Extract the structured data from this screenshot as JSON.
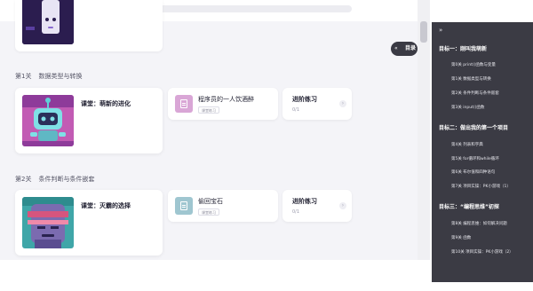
{
  "sections": [
    {
      "title_prefix": "第1关",
      "title_text": "数据类型与转换",
      "course": {
        "title": "课堂：萌新的进化"
      },
      "item": {
        "title": "程序员的一人饮酒醉",
        "tag": "课堂练习"
      },
      "practice": {
        "title": "进阶练习",
        "progress": "0/1"
      }
    },
    {
      "title_prefix": "第2关",
      "title_text": "条件判断与条件嵌套",
      "course": {
        "title": "课堂：灭霸的选择"
      },
      "item": {
        "title": "偷回宝石",
        "tag": "课堂练习"
      },
      "practice": {
        "title": "进阶练习",
        "progress": "0/1"
      }
    }
  ],
  "toggle": {
    "label": "目录",
    "icon": "chevron-double-left-icon"
  },
  "sidebar": {
    "collapse_icon": "chevron-double-right-icon",
    "goals": [
      {
        "title": "目标一：刚叫我萌新",
        "lessons": [
          "第0关 print()函数与变量",
          "第1关 数据类型与转换",
          "第2关 条件判断与条件嵌套",
          "第3关 input()函数"
        ]
      },
      {
        "title": "目标二：做出我的第一个项目",
        "lessons": [
          "第4关 列表和字典",
          "第5关 for循环和while循环",
          "第6关 布尔值和四种语句",
          "第7关 项目实操：PK小游戏（1）"
        ]
      },
      {
        "title": "目标三：“编程思维”初探",
        "lessons": [
          "第8关 编程思维：如何解决问题",
          "第9关 函数",
          "第10关 项目实操：PK小游戏（2）"
        ]
      }
    ]
  },
  "colors": {
    "sidebar_bg": "#3b3b44",
    "item_icon_1": "#d9a6d6",
    "item_icon_2": "#9fc6d0",
    "page_bg": "#f4f4f8"
  }
}
